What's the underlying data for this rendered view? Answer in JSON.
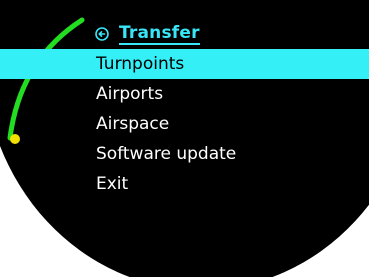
{
  "header": {
    "icon": "back-arrow-circle-icon",
    "title": "Transfer"
  },
  "menu": {
    "selected_index": 0,
    "items": [
      {
        "label": "Turnpoints"
      },
      {
        "label": "Airports"
      },
      {
        "label": "Airspace"
      },
      {
        "label": "Software update"
      },
      {
        "label": "Exit"
      }
    ]
  },
  "scroll_indicator": {
    "position_fraction": 0.0,
    "colors": {
      "track": "#22dd22",
      "thumb": "#f2e000"
    }
  },
  "colors": {
    "background": "#000000",
    "accent": "#38e6f7",
    "selected_bg": "#35eff7",
    "text": "#ffffff"
  }
}
